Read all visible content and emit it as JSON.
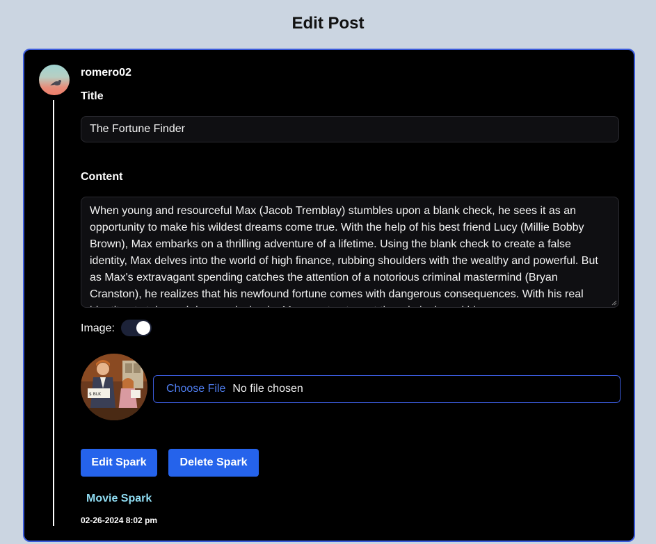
{
  "page": {
    "title": "Edit Post"
  },
  "post": {
    "username": "romero02",
    "title_label": "Title",
    "title_value": "The Fortune Finder",
    "content_label": "Content",
    "content_value": "When young and resourceful Max (Jacob Tremblay) stumbles upon a blank check, he sees it as an opportunity to make his wildest dreams come true. With the help of his best friend Lucy (Millie Bobby Brown), Max embarks on a thrilling adventure of a lifetime. Using the blank check to create a false identity, Max delves into the world of high finance, rubbing shoulders with the wealthy and powerful. But as Max's extravagant spending catches the attention of a notorious criminal mastermind (Bryan Cranston), he realizes that his newfound fortune comes with dangerous consequences. With his real identity at stake and danger closing in, Max must outsmart the criminals and his",
    "image_label": "Image:",
    "image_toggle_on": true,
    "file_input": {
      "button_label": "Choose File",
      "status": "No file chosen"
    },
    "edit_button": "Edit Spark",
    "delete_button": "Delete Spark",
    "tag": "Movie Spark",
    "timestamp": "02-26-2024 8:02 pm"
  },
  "colors": {
    "background": "#cbd5e1",
    "card": "#000000",
    "card_border": "#3b5bdb",
    "button": "#2563eb",
    "tag": "#8fdcf2"
  },
  "icons": {
    "avatar": "user-avatar",
    "post_image": "movie-still-thumbnail"
  }
}
